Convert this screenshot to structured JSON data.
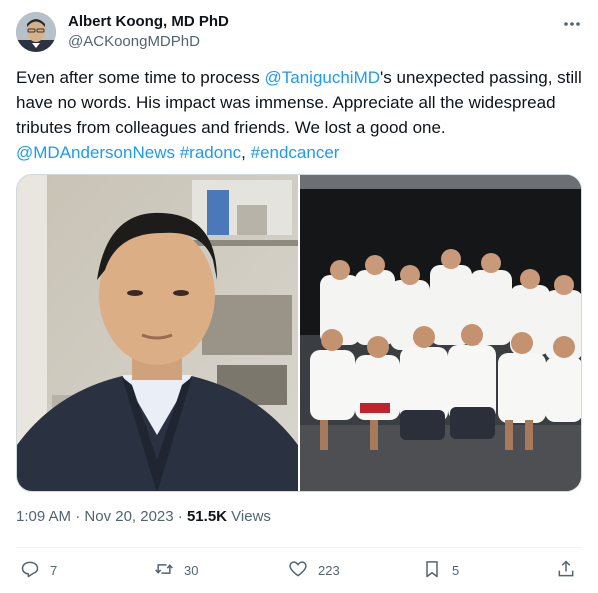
{
  "author": {
    "name": "Albert Koong, MD PhD",
    "handle": "@ACKoongMDPhD"
  },
  "tweet": {
    "text_part1": "Even after some time to process ",
    "mention1": "@TaniguchiMD",
    "text_part2": "'s unexpected passing, still have no words. His impact was immense. Appreciate all the widespread tributes from colleagues and friends. We lost a good one. ",
    "mention2": "@MDAndersonNews",
    "space": " ",
    "hashtag1": "#radonc",
    "comma": ", ",
    "hashtag2": "#endcancer"
  },
  "meta": {
    "time": "1:09 AM",
    "sep1": " · ",
    "date": "Nov 20, 2023",
    "sep2": " · ",
    "views_count": "51.5K",
    "views_label": " Views"
  },
  "actions": {
    "replies": "7",
    "reposts": "30",
    "likes": "223",
    "bookmarks": "5"
  },
  "icons": {
    "more": "more-icon",
    "reply": "reply-icon",
    "repost": "repost-icon",
    "like": "heart-icon",
    "bookmark": "bookmark-icon",
    "share": "share-icon"
  },
  "colors": {
    "link": "#1d9bf0",
    "secondary_text": "#536471",
    "primary_text": "#0f1419",
    "border": "#cfd9de"
  }
}
